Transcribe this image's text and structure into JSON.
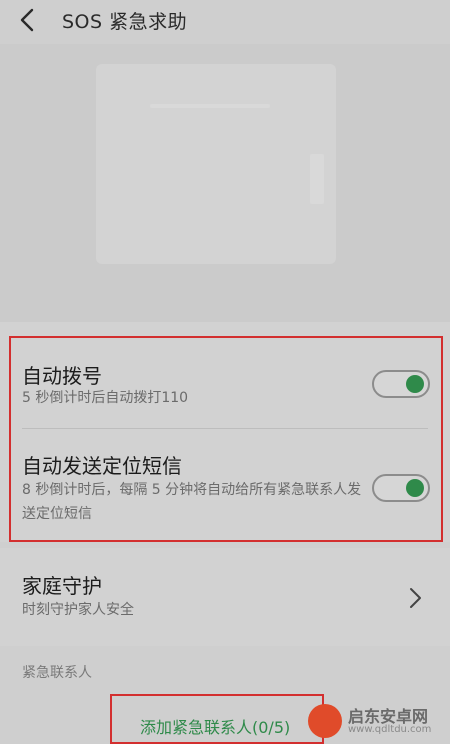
{
  "header": {
    "title": "SOS 紧急求助"
  },
  "auto_dial": {
    "title": "自动拨号",
    "subtitle": "5 秒倒计时后自动拨打110",
    "enabled": true
  },
  "auto_sms": {
    "title": "自动发送定位短信",
    "subtitle": "8 秒倒计时后，每隔 5 分钟将自动给所有紧急联系人发送定位短信",
    "enabled": true
  },
  "family_guard": {
    "title": "家庭守护",
    "subtitle": "时刻守护家人安全"
  },
  "contacts": {
    "group_label": "紧急联系人",
    "add_label": "添加紧急联系人(0/5)"
  },
  "watermark": {
    "name": "启东安卓网",
    "url": "www.qdltdu.com"
  },
  "colors": {
    "accent_green": "#2f8a4a",
    "highlight_red": "#d32f2f"
  }
}
